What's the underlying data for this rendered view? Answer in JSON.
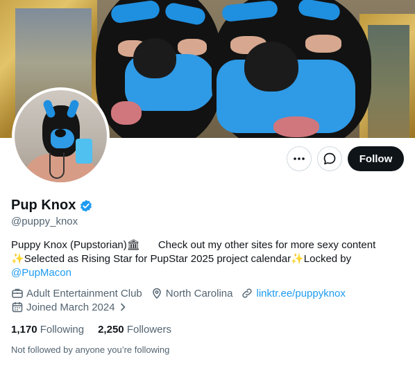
{
  "profile": {
    "name": "Pup Knox",
    "handle": "@puppy_knox",
    "verified_color": "#1d9bf0"
  },
  "actions": {
    "more_icon": "more-horizontal-icon",
    "message_icon": "message-icon",
    "follow_label": "Follow"
  },
  "bio": {
    "line1_a": "Puppy Knox (Pupstorian)",
    "line1_emoji": "🏛",
    "line1_b": "Check out my other sites for more sexy content",
    "sparkle": "✨",
    "line2_text": "Selected as Rising Star for PupStar 2025 project calendar",
    "line2_tail": "Locked by",
    "mention": "@PupMacon"
  },
  "meta": {
    "category": "Adult Entertainment Club",
    "location": "North Carolina",
    "website": "linktr.ee/puppyknox",
    "joined": "Joined March 2024"
  },
  "stats": {
    "following_count": "1,170",
    "following_label": "Following",
    "followers_count": "2,250",
    "followers_label": "Followers"
  },
  "notice": "Not followed by anyone you’re following",
  "colors": {
    "text": "#0f1419",
    "muted": "#536471",
    "accent": "#1d9bf0",
    "follow_bg": "#0f1419"
  }
}
